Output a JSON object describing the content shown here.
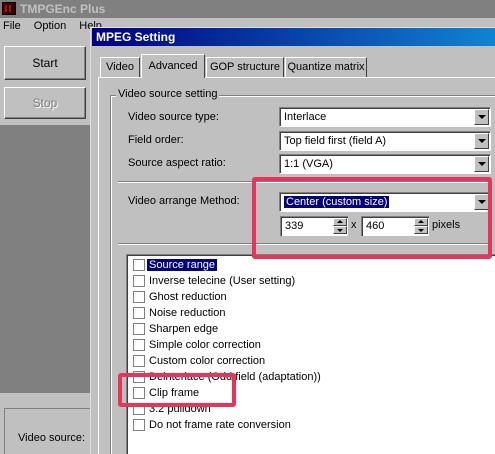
{
  "app": {
    "title": "TMPGEnc Plus",
    "menu": {
      "file": "File",
      "option": "Option",
      "help": "Help"
    },
    "start_label": "Start",
    "stop_label": "Stop",
    "video_source_label": "Video source:"
  },
  "dialog": {
    "title": "MPEG Setting",
    "tabs": [
      "Video",
      "Advanced",
      "GOP structure",
      "Quantize matrix"
    ],
    "active_tab": "Advanced",
    "group_title": "Video source setting",
    "fields": {
      "video_source_type": {
        "label": "Video source type:",
        "value": "Interlace"
      },
      "field_order": {
        "label": "Field order:",
        "value": "Top field first (field A)"
      },
      "source_aspect_ratio": {
        "label": "Source aspect ratio:",
        "value": "1:1 (VGA)"
      },
      "video_arrange_method": {
        "label": "Video arrange Method:",
        "value": "Center (custom size)"
      }
    },
    "width_value": "339",
    "height_value": "460",
    "times": "x",
    "pixels": "pixels",
    "filters": [
      {
        "label": "Source range",
        "checked": false,
        "selected": true
      },
      {
        "label": "Inverse telecine (User setting)",
        "checked": false
      },
      {
        "label": "Ghost reduction",
        "checked": false
      },
      {
        "label": "Noise reduction",
        "checked": false
      },
      {
        "label": "Sharpen edge",
        "checked": false
      },
      {
        "label": "Simple color correction",
        "checked": false
      },
      {
        "label": "Custom color correction",
        "checked": false
      },
      {
        "label": "Deinterlace (Odd field (adaptation))",
        "checked": false
      },
      {
        "label": "Clip frame",
        "checked": false
      },
      {
        "label": "3:2 pulldown",
        "checked": false
      },
      {
        "label": "Do not frame rate conversion",
        "checked": false
      }
    ],
    "annotation_color": "#e8335a"
  }
}
